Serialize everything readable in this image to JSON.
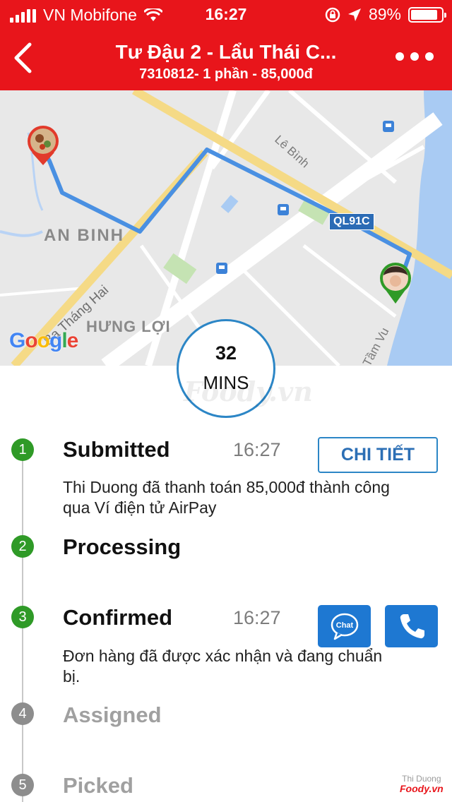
{
  "status_bar": {
    "carrier": "VN Mobifone",
    "time": "16:27",
    "battery": "89%",
    "battery_level": 0.89,
    "icons": [
      "signal-icon",
      "wifi-icon",
      "rotation-lock-icon",
      "location-icon",
      "battery-icon"
    ]
  },
  "header": {
    "title": "Tư Đậu 2 - Lẩu Thái C...",
    "subtitle": "7310812- 1 phần - 85,000đ",
    "icons": [
      "back-icon",
      "more-icon"
    ]
  },
  "map": {
    "labels": {
      "an_binh": "AN BINH",
      "hung_loi": "HƯNG LỢI",
      "le_binh": "Lê Bình",
      "ba_thang_hai": "Ba Tháng Hai",
      "tam_vu": "Tầm Vu",
      "road": "QL91C"
    },
    "google": "Google"
  },
  "timer": {
    "value": "32",
    "unit": "MINS",
    "watermark": "Foody.vn"
  },
  "steps": [
    {
      "number": "1",
      "title": "Submitted",
      "time": "16:27",
      "description": "Thi Duong đã thanh toán 85,000đ thành công qua Ví điện tử AirPay",
      "status": "done"
    },
    {
      "number": "2",
      "title": "Processing",
      "status": "done"
    },
    {
      "number": "3",
      "title": "Confirmed",
      "time": "16:27",
      "description": "Đơn hàng đã được xác nhận và đang chuẩn bị.",
      "status": "done"
    },
    {
      "number": "4",
      "title": "Assigned",
      "status": "pending"
    },
    {
      "number": "5",
      "title": "Picked",
      "status": "pending"
    }
  ],
  "actions": {
    "detail_label": "CHI TIẾT",
    "chat_label": "Chat"
  },
  "corner_mark": {
    "name": "Thi Duong",
    "brand": "Foody.vn"
  },
  "colors": {
    "brand_red": "#e8151b",
    "accent_blue": "#1e78d2",
    "done_green": "#2f9a27",
    "pending_gray": "#8d8d8d"
  }
}
